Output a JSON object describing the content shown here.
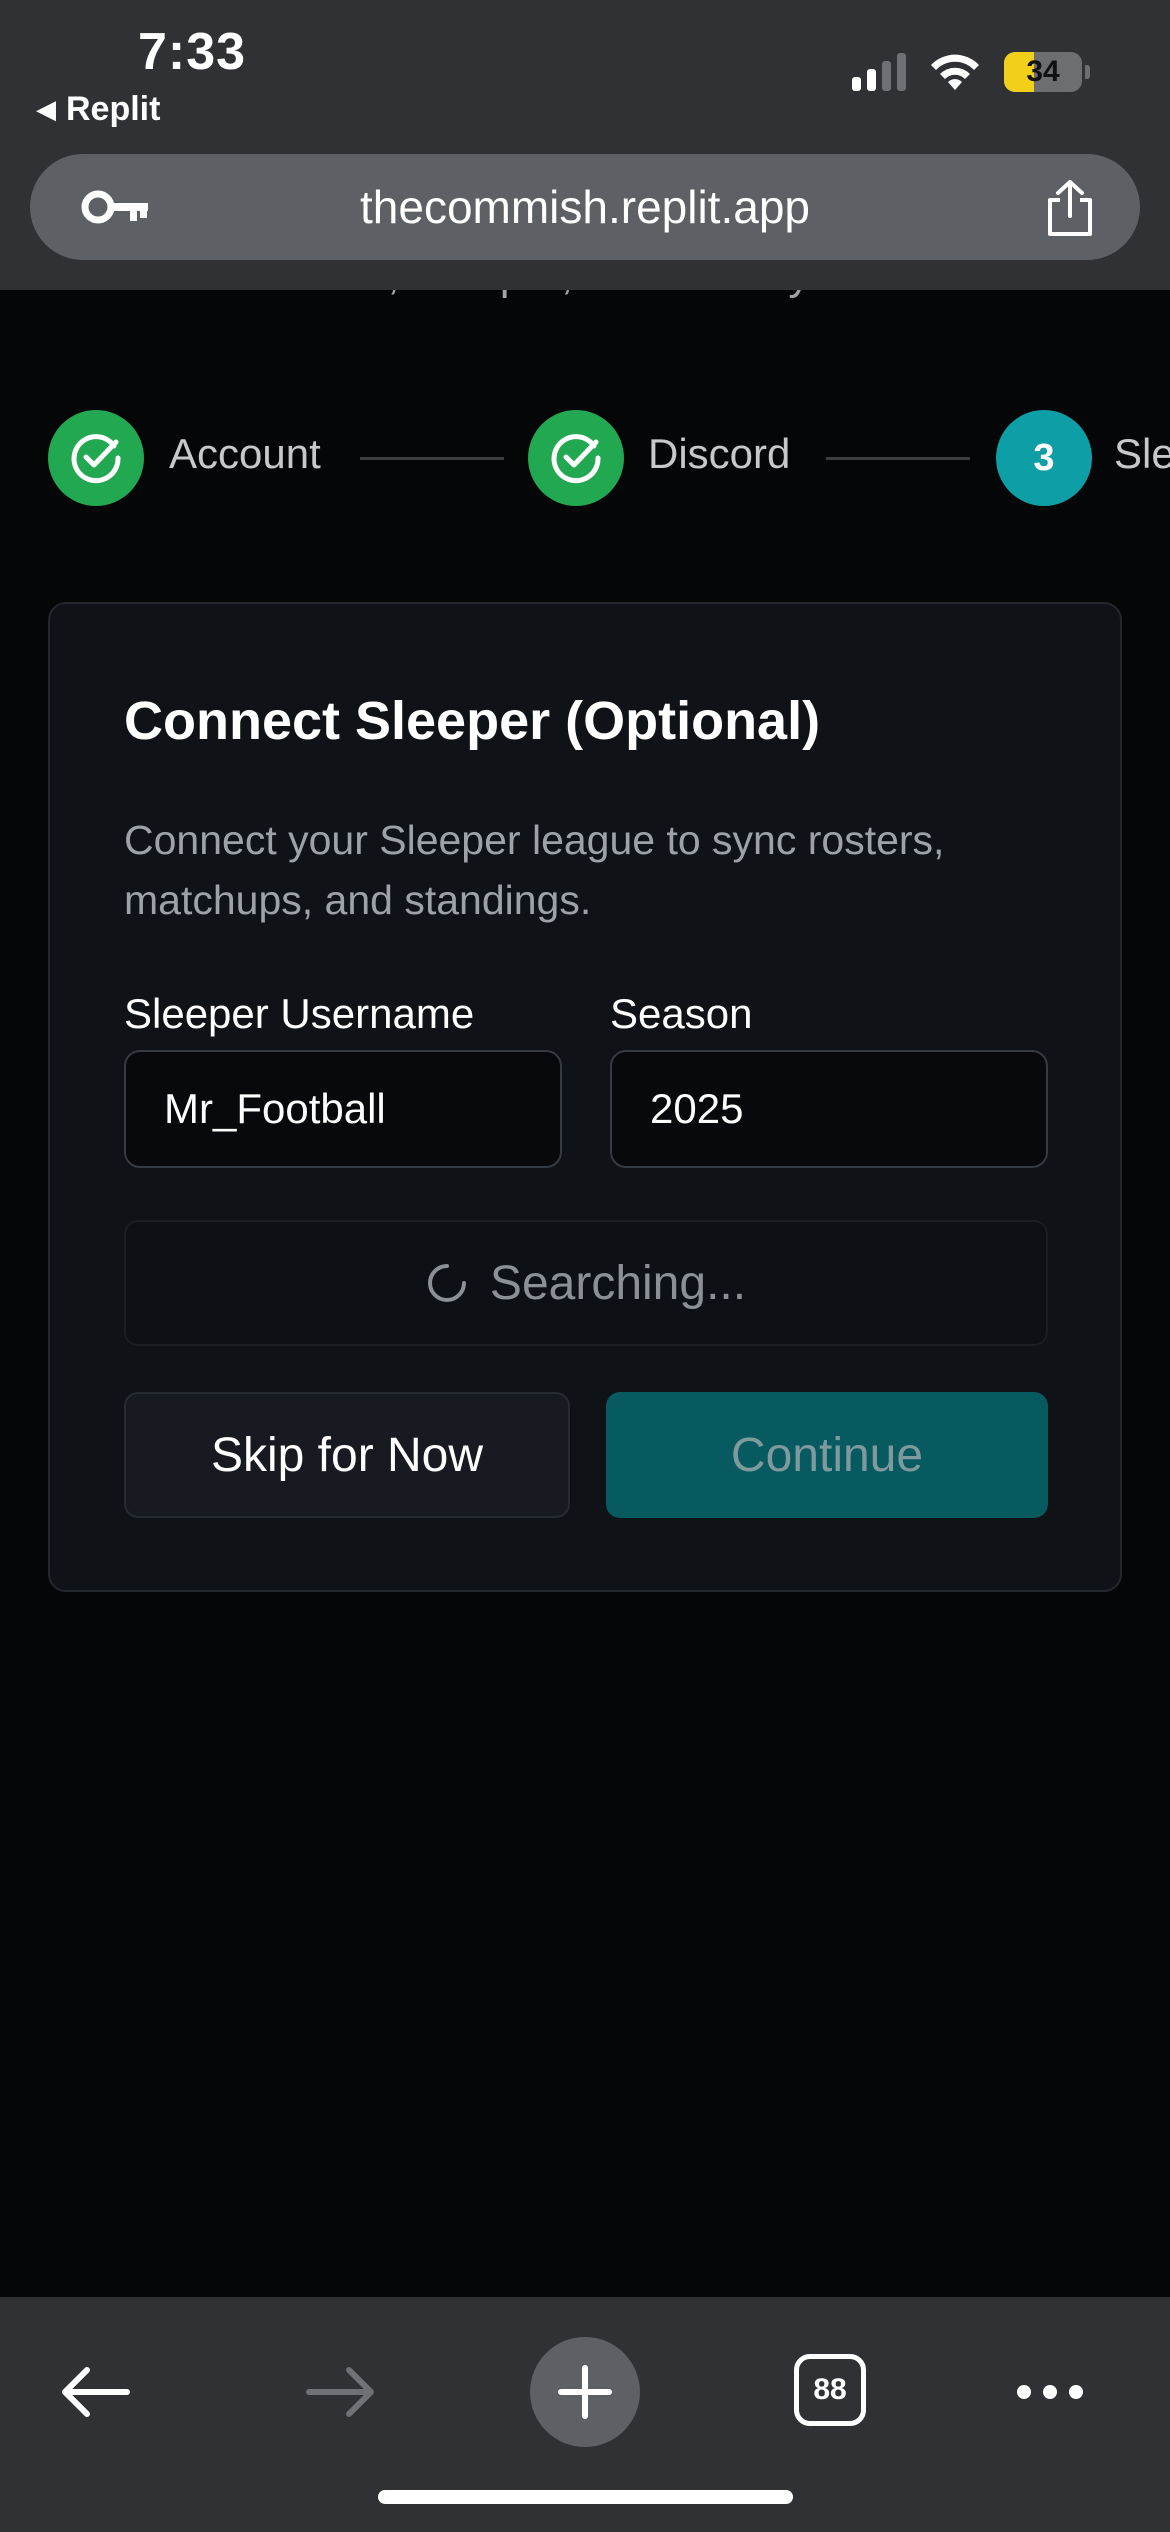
{
  "status_bar": {
    "time": "7:33",
    "back_app": "Replit",
    "battery_level": "34",
    "signal_bars_active": 2,
    "signal_bars_total": 4
  },
  "browser": {
    "url": "thecommish.replit.app",
    "tab_count": "88"
  },
  "page": {
    "partial_header_text": "Connect Discord, Sleeper, and index your rules",
    "stepper": {
      "steps": [
        {
          "label": "Account",
          "state": "done"
        },
        {
          "label": "Discord",
          "state": "done"
        },
        {
          "label": "Sleeper",
          "state": "active",
          "number": "3"
        }
      ]
    },
    "card": {
      "title": "Connect Sleeper (Optional)",
      "description": "Connect your Sleeper league to sync rosters, matchups, and standings.",
      "username_label": "Sleeper Username",
      "username_value": "Mr_Football",
      "season_label": "Season",
      "season_value": "2025",
      "search_status": "Searching...",
      "skip_label": "Skip for Now",
      "continue_label": "Continue"
    }
  },
  "colors": {
    "background": "#050607",
    "chrome": "#2f3134",
    "step_done": "#22a850",
    "step_active": "#0e9ea6",
    "continue_button": "#075a5f"
  }
}
